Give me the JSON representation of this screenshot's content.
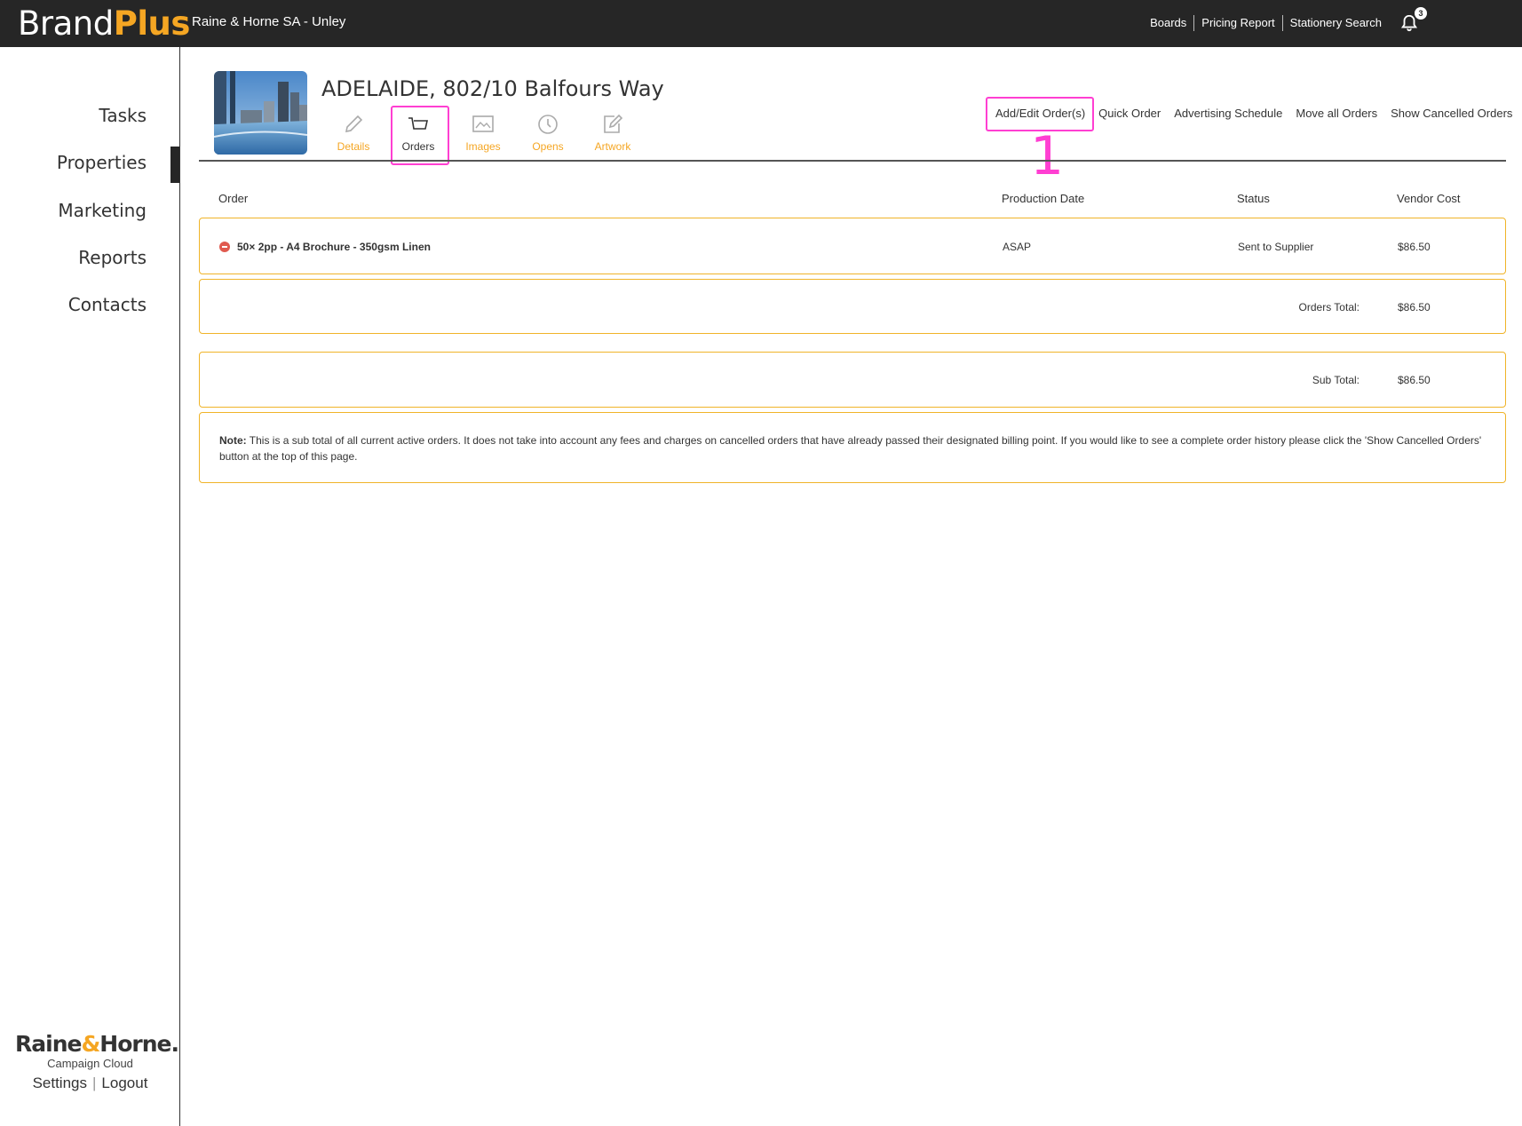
{
  "app": {
    "logo_brand": "Brand",
    "logo_plus": "Plus",
    "agency": "Raine & Horne SA - Unley",
    "top_links": [
      "Boards",
      "Pricing Report",
      "Stationery Search"
    ],
    "notification_count": "3"
  },
  "sidebar": {
    "items": [
      "Tasks",
      "Properties",
      "Marketing",
      "Reports",
      "Contacts"
    ],
    "active": "Properties",
    "footer_logo_left": "Raine",
    "footer_logo_amp": "&",
    "footer_logo_right": "Horne.",
    "footer_sub": "Campaign Cloud",
    "settings": "Settings",
    "logout": "Logout"
  },
  "property": {
    "title": "ADELAIDE, 802/10 Balfours Way",
    "tabs": [
      {
        "label": "Details",
        "icon": "pencil-icon"
      },
      {
        "label": "Orders",
        "icon": "cart-icon"
      },
      {
        "label": "Images",
        "icon": "image-icon"
      },
      {
        "label": "Opens",
        "icon": "clock-icon"
      },
      {
        "label": "Artwork",
        "icon": "edit-square-icon"
      }
    ],
    "active_tab": "Orders"
  },
  "actions": [
    "Add/Edit Order(s)",
    "Quick Order",
    "Advertising Schedule",
    "Move all Orders",
    "Show Cancelled Orders"
  ],
  "annotation": "1",
  "table": {
    "columns": [
      "Order",
      "Production Date",
      "Status",
      "Vendor Cost"
    ],
    "rows": [
      {
        "order": "50× 2pp - A4 Brochure - 350gsm Linen",
        "production_date": "ASAP",
        "status": "Sent to Supplier",
        "vendor_cost": "$86.50"
      }
    ],
    "orders_total_label": "Orders Total:",
    "orders_total": "$86.50",
    "sub_total_label": "Sub Total:",
    "sub_total": "$86.50"
  },
  "note": {
    "label": "Note:",
    "text": "This is a sub total of all current active orders. It does not take into account any fees and charges on cancelled orders that have already passed their designated billing point. If you would like to see a complete order history please click the 'Show Cancelled Orders' button at the top of this page."
  },
  "colors": {
    "accent": "#f5a623",
    "topbar": "#262626",
    "highlight": "#ff3fd2",
    "box_border": "#f0b429"
  }
}
